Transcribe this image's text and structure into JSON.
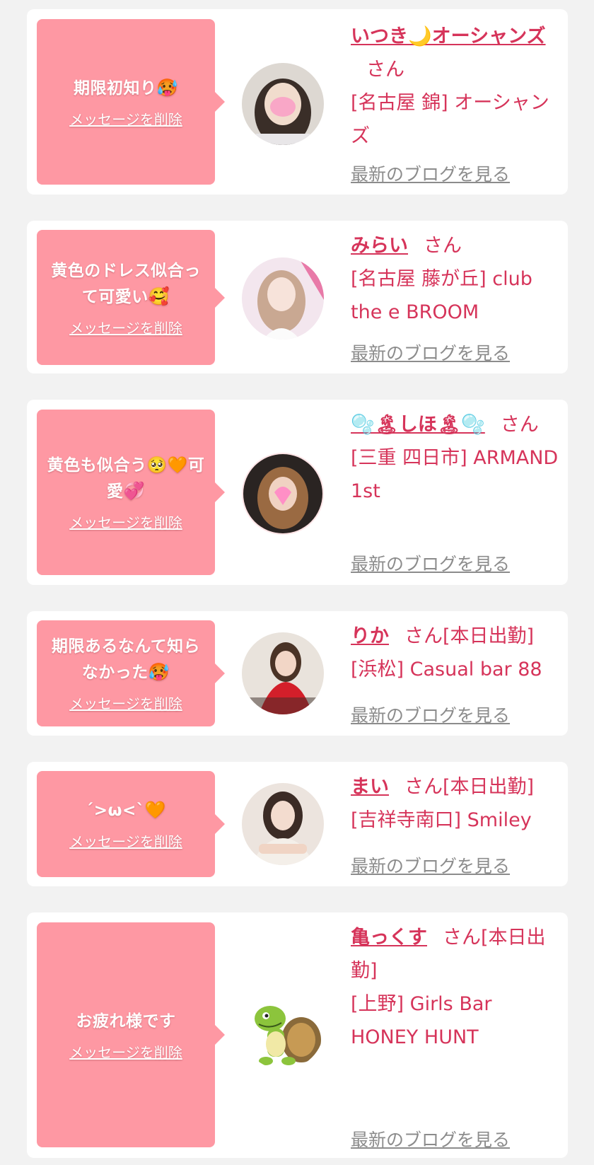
{
  "common": {
    "delete_label": "メッセージを削除",
    "blog_label": "最新のブログを見る",
    "honorific": "さん"
  },
  "colors": {
    "background": "#f2f2f2",
    "card": "#ffffff",
    "bubble": "#fe98a3",
    "name_text": "#d6345a",
    "blog_link": "#8c8c8c"
  },
  "cards": [
    {
      "message": "期限初知り",
      "message_emoji": "🥵",
      "name": "いつき🌙オーシャンズ",
      "status": "",
      "shop": "[名古屋 錦] オーシャンズ",
      "avatar": "woman-portrait-blurred"
    },
    {
      "message": "黄色のドレス似合って可愛い",
      "message_emoji": "🥰",
      "name": "みらい",
      "status": "",
      "shop": "[名古屋 藤が丘] club the e BROOM",
      "avatar": "woman-portrait-light"
    },
    {
      "message": "黄色も似合う🥺🧡可愛",
      "message_emoji": "💞",
      "name": "🫧🏝しほ🏝🫧",
      "status": "",
      "shop": "[三重 四日市] ARMAND 1st",
      "avatar": "woman-portrait-dark"
    },
    {
      "message": "期限あるなんて知らなかった",
      "message_emoji": "🥵",
      "name": "りか",
      "status": "[本日出勤]",
      "shop": "[浜松] Casual bar 88",
      "avatar": "woman-red-dress"
    },
    {
      "message": "´>ω<`",
      "message_emoji": "🧡",
      "name": "まい",
      "status": "[本日出勤]",
      "shop": "[吉祥寺南口] Smiley",
      "avatar": "woman-portrait-hands"
    },
    {
      "message": "お疲れ様です",
      "message_emoji": "",
      "name": "亀っくす",
      "status": "[本日出勤]",
      "shop": "[上野] Girls Bar HONEY HUNT",
      "avatar": "turtle-cartoon"
    }
  ]
}
